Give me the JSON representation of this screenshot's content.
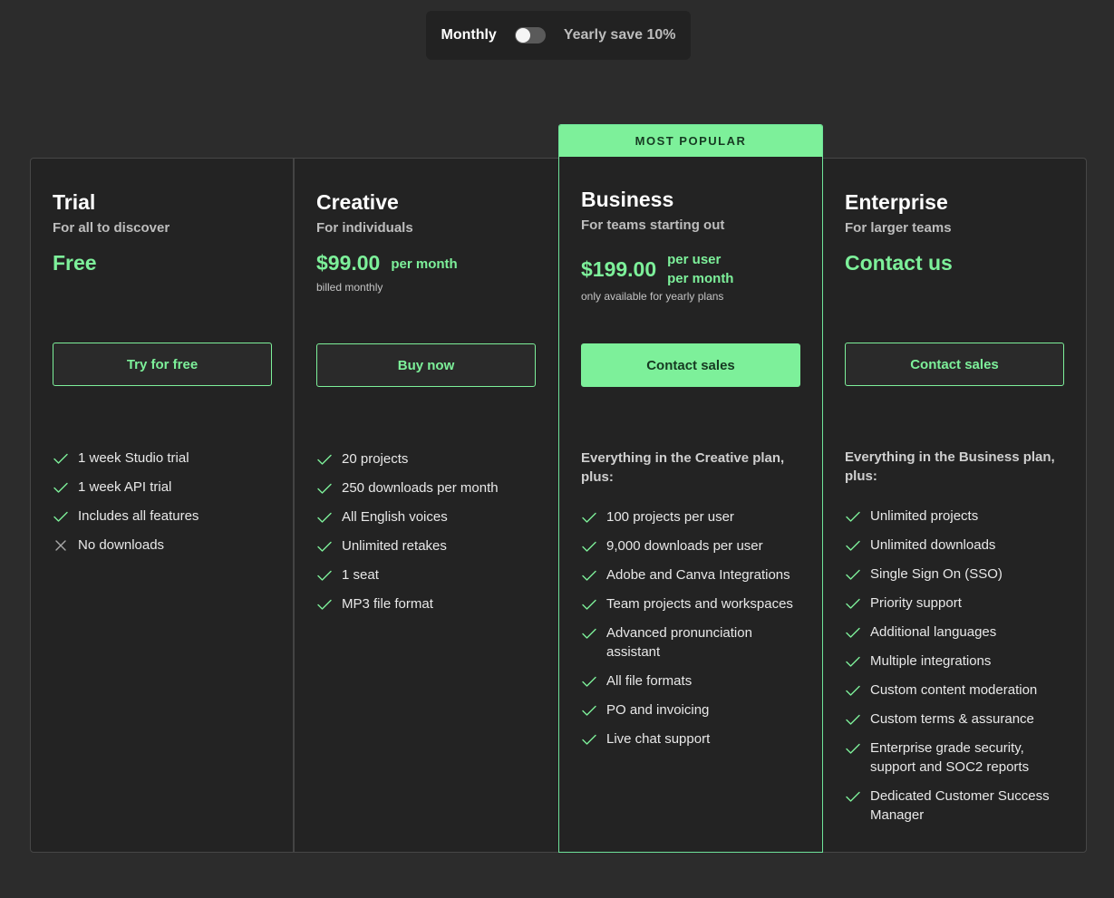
{
  "toggle": {
    "monthly_label": "Monthly",
    "yearly_label": "Yearly save 10%",
    "selected": "Monthly"
  },
  "colors": {
    "accent": "#7df09a",
    "background": "#2c2c2c",
    "card": "#232323"
  },
  "plans": {
    "trial": {
      "name": "Trial",
      "subtitle": "For all to discover",
      "price": "Free",
      "button": "Try for free",
      "features": [
        {
          "text": "1 week Studio trial",
          "icon": "check-icon"
        },
        {
          "text": "1 week API trial",
          "icon": "check-icon"
        },
        {
          "text": "Includes all features",
          "icon": "check-icon"
        },
        {
          "text": "No downloads",
          "icon": "cross-icon"
        }
      ]
    },
    "creative": {
      "name": "Creative",
      "subtitle": "For individuals",
      "price": "$99.00",
      "per": "per month",
      "note": "billed monthly",
      "button": "Buy now",
      "features": [
        {
          "text": "20 projects",
          "icon": "check-icon"
        },
        {
          "text": "250 downloads per month",
          "icon": "check-icon"
        },
        {
          "text": "All English voices",
          "icon": "check-icon"
        },
        {
          "text": "Unlimited retakes",
          "icon": "check-icon"
        },
        {
          "text": "1 seat",
          "icon": "check-icon"
        },
        {
          "text": "MP3 file format",
          "icon": "check-icon"
        }
      ]
    },
    "business": {
      "badge": "MOST POPULAR",
      "name": "Business",
      "subtitle": "For teams starting out",
      "price": "$199.00",
      "per_line1": "per user",
      "per_line2": "per month",
      "note": "only available for yearly plans",
      "button": "Contact sales",
      "features_heading": "Everything in the Creative plan, plus:",
      "features": [
        {
          "text": "100 projects per user",
          "icon": "check-icon"
        },
        {
          "text": "9,000 downloads per user",
          "icon": "check-icon"
        },
        {
          "text": "Adobe and Canva Integrations",
          "icon": "check-icon"
        },
        {
          "text": "Team projects and workspaces",
          "icon": "check-icon"
        },
        {
          "text": "Advanced pronunciation assistant",
          "icon": "check-icon"
        },
        {
          "text": "All file formats",
          "icon": "check-icon"
        },
        {
          "text": "PO and invoicing",
          "icon": "check-icon"
        },
        {
          "text": "Live chat support",
          "icon": "check-icon"
        }
      ]
    },
    "enterprise": {
      "name": "Enterprise",
      "subtitle": "For larger teams",
      "price": "Contact us",
      "button": "Contact sales",
      "features_heading": "Everything in the Business plan, plus:",
      "features": [
        {
          "text": "Unlimited projects",
          "icon": "check-icon"
        },
        {
          "text": "Unlimited downloads",
          "icon": "check-icon"
        },
        {
          "text": "Single Sign On (SSO)",
          "icon": "check-icon"
        },
        {
          "text": "Priority support",
          "icon": "check-icon"
        },
        {
          "text": "Additional languages",
          "icon": "check-icon"
        },
        {
          "text": "Multiple integrations",
          "icon": "check-icon"
        },
        {
          "text": "Custom content moderation",
          "icon": "check-icon"
        },
        {
          "text": "Custom terms & assurance",
          "icon": "check-icon"
        },
        {
          "text": "Enterprise grade security, support and SOC2 reports",
          "icon": "check-icon"
        },
        {
          "text": "Dedicated Customer Success Manager",
          "icon": "check-icon"
        }
      ]
    }
  }
}
